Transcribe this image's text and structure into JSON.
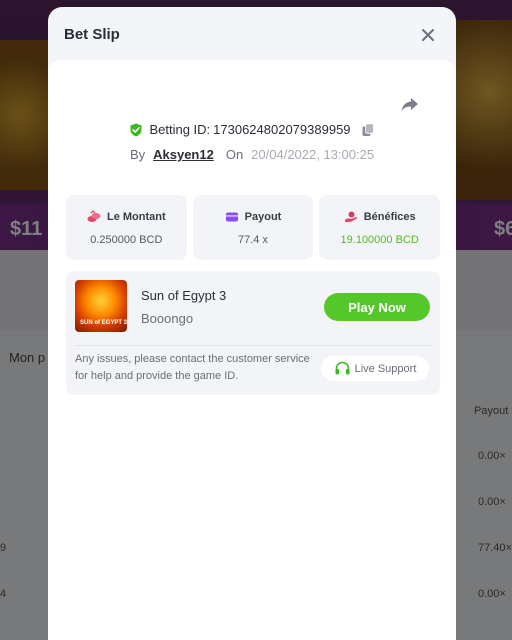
{
  "background": {
    "amount_left": "$11",
    "amount_right": "$6",
    "tab_text": "Mon p",
    "column_header": "Payout",
    "payout_values": [
      "0.00×",
      "0.00×",
      "77.40×",
      "0.00×"
    ],
    "left_numbers": [
      "9",
      "4"
    ]
  },
  "modal": {
    "title": "Bet Slip",
    "betting_id_label": "Betting ID:",
    "betting_id": "1730624802079389959",
    "by_label": "By",
    "username": "Aksyen12",
    "on_label": "On",
    "date": "20/04/2022, 13:00:25",
    "stats": [
      {
        "label": "Le Montant",
        "value": "0.250000 BCD",
        "icon": "coins-icon"
      },
      {
        "label": "Payout",
        "value": "77.4 x",
        "icon": "wallet-icon"
      },
      {
        "label": "Bénéfices",
        "value": "19.100000 BCD",
        "icon": "profit-icon"
      }
    ],
    "game": {
      "name": "Sun of Egypt 3",
      "provider": "Booongo",
      "thumb_text": "SUN of EGYPT 3",
      "play_label": "Play Now"
    },
    "support_text": "Any issues, please contact the customer service for help and provide the game ID.",
    "support_label": "Live Support"
  },
  "colors": {
    "accent_green": "#54c82a",
    "profit_green": "#4ec21b"
  }
}
